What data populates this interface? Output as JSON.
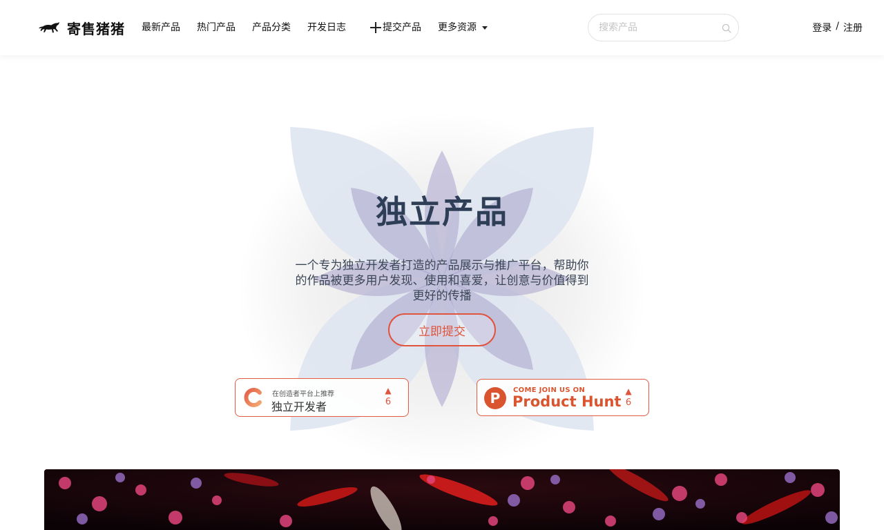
{
  "header": {
    "logo_text": "寄售猪猪",
    "nav": [
      "最新产品",
      "热门产品",
      "产品分类",
      "开发日志"
    ],
    "submit_label": "提交产品",
    "more_label": "更多资源",
    "search_placeholder": "搜索产品",
    "auth": {
      "login": "登录",
      "separator": "/",
      "register": "注册"
    }
  },
  "hero": {
    "title": "独立产品",
    "description": "一个专为独立开发者打造的产品展示与推广平台，帮助你的作品被更多用户发现、使用和喜爱，让创意与价值得到更好的传播",
    "cta_label": "立即提交"
  },
  "badges": {
    "chuangye": {
      "small": "在创造者平台上推荐",
      "name": "独立开发者",
      "votes": "6"
    },
    "producthunt": {
      "small": "COME JOIN US ON",
      "name": "Product Hunt",
      "votes": "6"
    }
  },
  "icons": {
    "logo": "horse-icon",
    "search": "search-icon",
    "plus": "plus-icon",
    "caret": "chevron-down-icon",
    "upvote": "triangle-up-icon"
  },
  "colors": {
    "accent": "#e0533d",
    "producthunt": "#da552f",
    "title": "#2e3e56",
    "flower_outer": "#dfe5f0",
    "flower_inner": "#b9b4d6"
  }
}
